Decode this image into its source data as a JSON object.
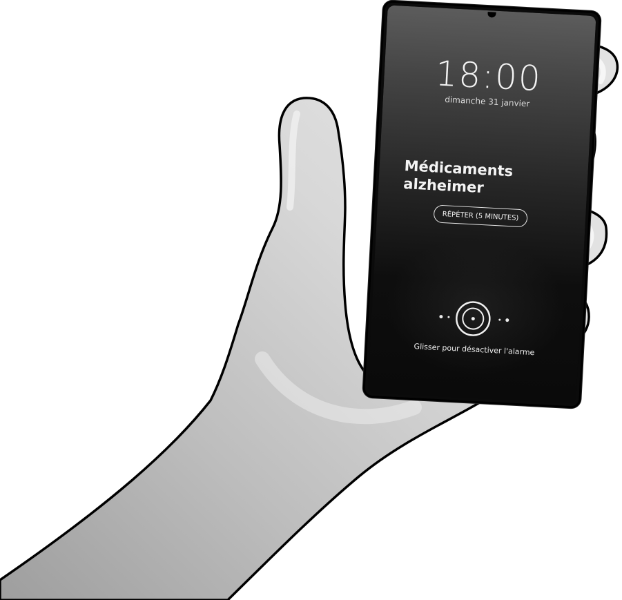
{
  "lockscreen": {
    "time": "18:00",
    "date": "dimanche 31 janvier"
  },
  "alarm": {
    "title_line1": "Médicaments",
    "title_line2": "alzheimer",
    "snooze_label": "RÉPÉTER (5 MINUTES)",
    "dismiss_hint": "Glisser pour désactiver l'alarme",
    "dismiss_icon": "alarm-dismiss-handle-icon"
  },
  "colors": {
    "screen_top": "#5c5c5c",
    "screen_bottom": "#0a0a0a",
    "text": "#f2f2f2",
    "phone_body": "#0b0b0b",
    "hand_fill": "#dcdcdc",
    "hand_outline": "#000000"
  }
}
